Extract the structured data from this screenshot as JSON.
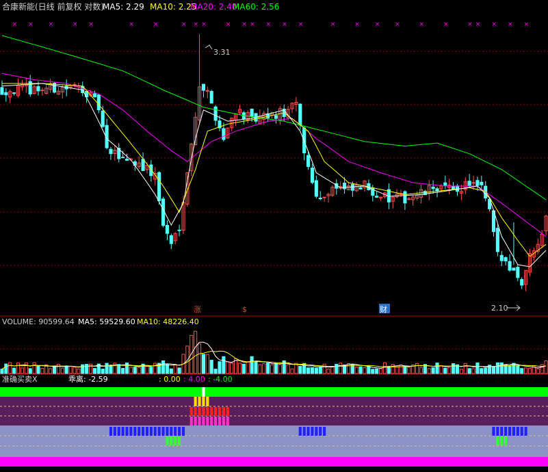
{
  "header": {
    "title": "合康新能(日线 前复权 对数)",
    "ma5": "MA5: 2.29",
    "ma10": "MA10: 2.25",
    "ma20": "MA20: 2.40",
    "ma60": "MA60: 2.56"
  },
  "price_panel": {
    "high_label": "3.31",
    "low_label": "2.10",
    "event_markers": [
      "涨",
      "$",
      "财"
    ]
  },
  "volume_panel": {
    "volume": "VOLUME: 90599.64",
    "ma5": "MA5: 59529.60",
    "ma10": "MA10: 48226.40"
  },
  "indicator_panel": {
    "name": "准确买卖X",
    "deviation": "乖离: -2.59",
    "v1": ": 0.00",
    "v2": ": 4.00",
    "v3": ": -4.00"
  },
  "colors": {
    "up": "#ff5050",
    "down": "#54ffff",
    "ma5": "#ffffff",
    "ma10": "#ffff00",
    "ma20": "#ff00ff",
    "ma60": "#00ff00",
    "grid": "#8b0000",
    "marker_x": "#ff00ff"
  },
  "chart_data": {
    "type": "candlestick",
    "scale": "log",
    "bars": 136,
    "close_path": [
      [
        0,
        2.85
      ],
      [
        10,
        2.86
      ],
      [
        20,
        2.87
      ],
      [
        24,
        2.72
      ],
      [
        26,
        2.41
      ],
      [
        30,
        2.38
      ],
      [
        34,
        2.34
      ],
      [
        38,
        2.26
      ],
      [
        40,
        1.98
      ],
      [
        42,
        1.88
      ],
      [
        44,
        1.98
      ],
      [
        47,
        2.45
      ],
      [
        49,
        2.9
      ],
      [
        51,
        2.82
      ],
      [
        55,
        2.5
      ],
      [
        58,
        2.71
      ],
      [
        62,
        2.62
      ],
      [
        66,
        2.65
      ],
      [
        70,
        2.68
      ],
      [
        73,
        2.73
      ],
      [
        75,
        2.42
      ],
      [
        77,
        2.22
      ],
      [
        79,
        2.12
      ],
      [
        82,
        2.2
      ],
      [
        86,
        2.17
      ],
      [
        90,
        2.2
      ],
      [
        96,
        2.12
      ],
      [
        100,
        2.13
      ],
      [
        104,
        2.15
      ],
      [
        108,
        2.2
      ],
      [
        112,
        2.17
      ],
      [
        116,
        2.22
      ],
      [
        119,
        2.18
      ],
      [
        121,
        2.05
      ],
      [
        123,
        1.82
      ],
      [
        126,
        1.78
      ],
      [
        129,
        1.7
      ],
      [
        131,
        1.82
      ],
      [
        134,
        1.95
      ],
      [
        135,
        2.05
      ]
    ],
    "ma5": [
      [
        0,
        2.88
      ],
      [
        10,
        2.9
      ],
      [
        20,
        2.85
      ],
      [
        26,
        2.5
      ],
      [
        32,
        2.36
      ],
      [
        38,
        2.15
      ],
      [
        42,
        1.98
      ],
      [
        45,
        2.1
      ],
      [
        48,
        2.5
      ],
      [
        50,
        2.7
      ],
      [
        56,
        2.62
      ],
      [
        62,
        2.64
      ],
      [
        70,
        2.7
      ],
      [
        74,
        2.55
      ],
      [
        78,
        2.28
      ],
      [
        84,
        2.19
      ],
      [
        90,
        2.2
      ],
      [
        96,
        2.14
      ],
      [
        104,
        2.15
      ],
      [
        110,
        2.17
      ],
      [
        118,
        2.2
      ],
      [
        121,
        2.13
      ],
      [
        124,
        1.92
      ],
      [
        128,
        1.78
      ],
      [
        131,
        1.77
      ],
      [
        135,
        1.85
      ]
    ],
    "ma10": [
      [
        0,
        2.9
      ],
      [
        10,
        2.9
      ],
      [
        20,
        2.88
      ],
      [
        28,
        2.6
      ],
      [
        34,
        2.4
      ],
      [
        40,
        2.2
      ],
      [
        44,
        2.05
      ],
      [
        48,
        2.3
      ],
      [
        51,
        2.55
      ],
      [
        56,
        2.6
      ],
      [
        62,
        2.63
      ],
      [
        70,
        2.68
      ],
      [
        76,
        2.55
      ],
      [
        80,
        2.35
      ],
      [
        86,
        2.22
      ],
      [
        94,
        2.18
      ],
      [
        100,
        2.15
      ],
      [
        108,
        2.17
      ],
      [
        116,
        2.19
      ],
      [
        120,
        2.17
      ],
      [
        124,
        2.02
      ],
      [
        128,
        1.9
      ],
      [
        131,
        1.82
      ],
      [
        135,
        1.88
      ]
    ],
    "ma20": [
      [
        0,
        2.98
      ],
      [
        8,
        2.93
      ],
      [
        16,
        2.9
      ],
      [
        24,
        2.82
      ],
      [
        30,
        2.7
      ],
      [
        36,
        2.55
      ],
      [
        42,
        2.42
      ],
      [
        46,
        2.35
      ],
      [
        52,
        2.48
      ],
      [
        58,
        2.55
      ],
      [
        66,
        2.62
      ],
      [
        72,
        2.64
      ],
      [
        78,
        2.5
      ],
      [
        86,
        2.35
      ],
      [
        94,
        2.28
      ],
      [
        102,
        2.22
      ],
      [
        110,
        2.2
      ],
      [
        118,
        2.2
      ],
      [
        124,
        2.1
      ],
      [
        130,
        2.0
      ],
      [
        135,
        1.92
      ]
    ],
    "ma60": [
      [
        0,
        3.3
      ],
      [
        10,
        3.2
      ],
      [
        20,
        3.1
      ],
      [
        30,
        3.0
      ],
      [
        40,
        2.85
      ],
      [
        50,
        2.72
      ],
      [
        60,
        2.66
      ],
      [
        70,
        2.62
      ],
      [
        80,
        2.55
      ],
      [
        90,
        2.48
      ],
      [
        100,
        2.45
      ],
      [
        108,
        2.47
      ],
      [
        116,
        2.4
      ],
      [
        124,
        2.3
      ],
      [
        130,
        2.2
      ],
      [
        135,
        2.12
      ]
    ],
    "high": 3.31,
    "low": 2.1,
    "ylim": [
      1.55,
      3.5
    ],
    "volume": {
      "last": 90599.64,
      "ma5": 59529.6,
      "ma10": 48226.4,
      "base_level": 20,
      "spikes": [
        [
          40,
          30
        ],
        [
          46,
          65
        ],
        [
          47,
          90
        ],
        [
          48,
          100
        ],
        [
          49,
          65
        ],
        [
          51,
          45
        ],
        [
          55,
          40
        ],
        [
          58,
          35
        ],
        [
          62,
          40
        ],
        [
          70,
          30
        ],
        [
          121,
          18
        ],
        [
          135,
          30
        ]
      ],
      "ylim": [
        0,
        110
      ]
    }
  }
}
